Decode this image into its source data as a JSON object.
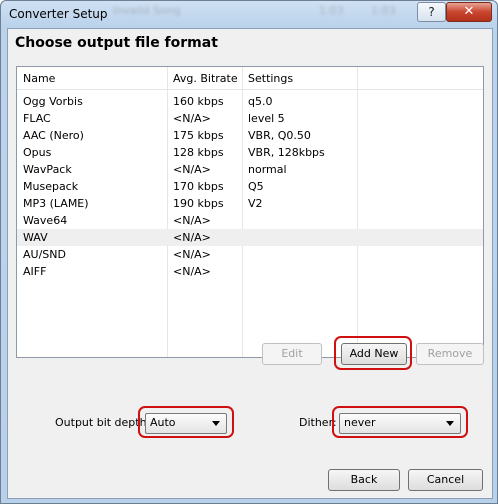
{
  "window": {
    "title": "Converter Setup",
    "help_glyph": "?",
    "close_glyph": "✕",
    "bg_text": [
      "Invalid Song",
      "1:03",
      "1:03"
    ]
  },
  "heading": "Choose output file format",
  "columns": [
    "Name",
    "Avg. Bitrate",
    "Settings"
  ],
  "formats": [
    {
      "name": "Ogg Vorbis",
      "bitrate": "160 kbps",
      "settings": "q5.0"
    },
    {
      "name": "FLAC",
      "bitrate": "<N/A>",
      "settings": "level 5"
    },
    {
      "name": "AAC (Nero)",
      "bitrate": "175 kbps",
      "settings": "VBR, Q0.50"
    },
    {
      "name": "Opus",
      "bitrate": "128 kbps",
      "settings": "VBR, 128kbps"
    },
    {
      "name": "WavPack",
      "bitrate": "<N/A>",
      "settings": "normal"
    },
    {
      "name": "Musepack",
      "bitrate": "170 kbps",
      "settings": "Q5"
    },
    {
      "name": "MP3 (LAME)",
      "bitrate": "190 kbps",
      "settings": "V2"
    },
    {
      "name": "Wave64",
      "bitrate": "<N/A>",
      "settings": ""
    },
    {
      "name": "WAV",
      "bitrate": "<N/A>",
      "settings": "",
      "selected": true
    },
    {
      "name": "AU/SND",
      "bitrate": "<N/A>",
      "settings": ""
    },
    {
      "name": "AIFF",
      "bitrate": "<N/A>",
      "settings": ""
    }
  ],
  "buttons": {
    "edit": "Edit",
    "add_new": "Add New",
    "remove": "Remove",
    "back": "Back",
    "cancel": "Cancel"
  },
  "bit_depth": {
    "label": "Output bit depth:",
    "value": "Auto"
  },
  "dither": {
    "label": "Dither:",
    "value": "never"
  },
  "colors": {
    "highlight": "#d01010",
    "selected_row": "#efefef"
  }
}
